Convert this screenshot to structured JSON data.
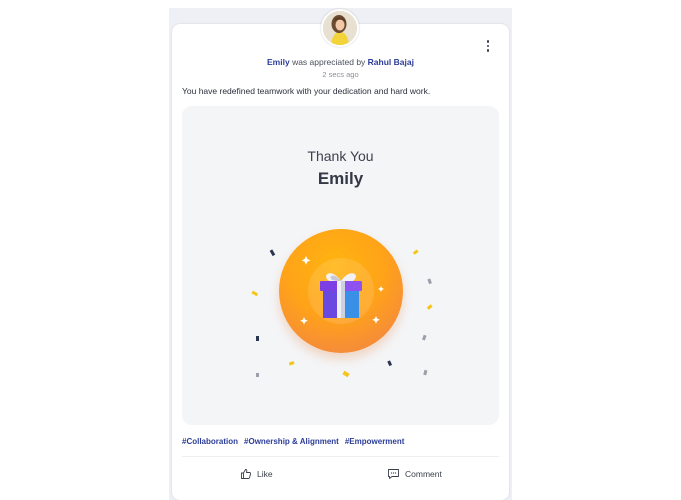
{
  "post": {
    "recipient_name": "Emily",
    "action_text": " was appreciated by ",
    "giver_name": "Rahul Bajaj",
    "timestamp": "2 secs ago",
    "message": "You have redefined teamwork with your dedication and hard work.",
    "card": {
      "title": "Thank You",
      "recipient": "Emily"
    },
    "tags": [
      "#Collaboration",
      "#Ownership & Alignment",
      "#Empowerment"
    ]
  },
  "actions": {
    "like_label": "Like",
    "comment_label": "Comment"
  },
  "colors": {
    "accent": "#2c3d99",
    "badge_orange": "#ffa319",
    "badge_coral": "#f27a4a",
    "gift_purple": "#7b3fe4",
    "gift_blue": "#2d8ae0"
  },
  "icons": {
    "more": "more-vertical-icon",
    "like": "thumbs-up-icon",
    "comment": "comment-icon",
    "gift": "gift-icon"
  }
}
